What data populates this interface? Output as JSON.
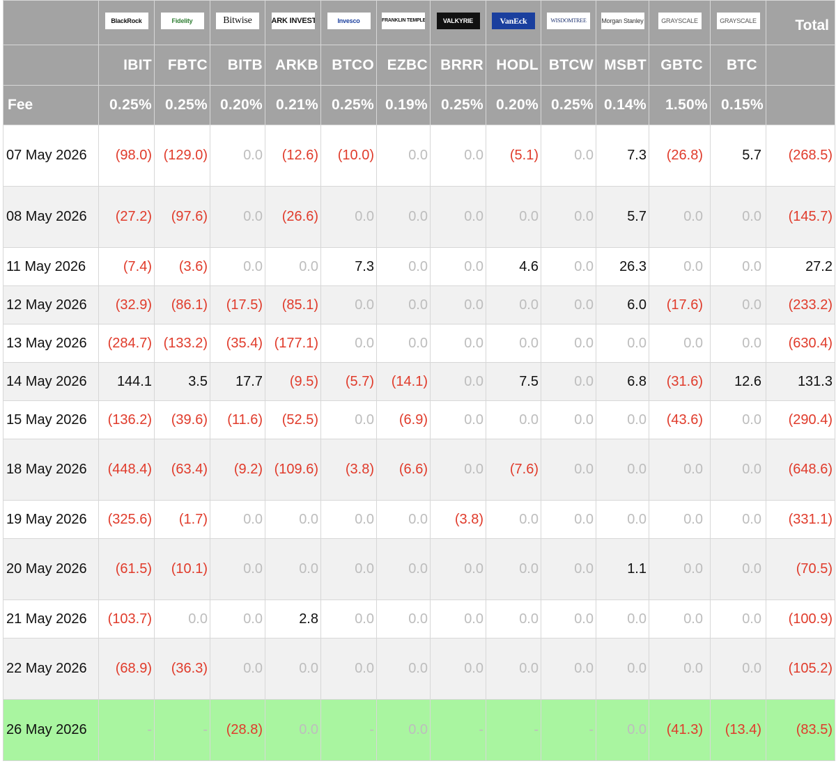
{
  "header": {
    "total_label": "Total",
    "fee_label": "Fee"
  },
  "funds": [
    {
      "logo": "BlackRock",
      "ticker": "IBIT",
      "fee": "0.25%"
    },
    {
      "logo": "Fidelity",
      "ticker": "FBTC",
      "fee": "0.25%"
    },
    {
      "logo": "Bitwise",
      "ticker": "BITB",
      "fee": "0.20%"
    },
    {
      "logo": "ARK INVEST",
      "ticker": "ARKB",
      "fee": "0.21%"
    },
    {
      "logo": "Invesco",
      "ticker": "BTCO",
      "fee": "0.25%"
    },
    {
      "logo": "FRANKLIN TEMPLETON",
      "ticker": "EZBC",
      "fee": "0.19%"
    },
    {
      "logo": "VALKYRIE",
      "ticker": "BRRR",
      "fee": "0.25%"
    },
    {
      "logo": "VanEck",
      "ticker": "HODL",
      "fee": "0.20%"
    },
    {
      "logo": "WISDOMTREE",
      "ticker": "BTCW",
      "fee": "0.25%"
    },
    {
      "logo": "Morgan Stanley",
      "ticker": "MSBT",
      "fee": "0.14%"
    },
    {
      "logo": "GRAYSCALE",
      "ticker": "GBTC",
      "fee": "1.50%"
    },
    {
      "logo": "GRAYSCALE",
      "ticker": "BTC",
      "fee": "0.15%"
    }
  ],
  "rows": [
    {
      "date": "07 May 2026",
      "values": [
        "(98.0)",
        "(129.0)",
        "0.0",
        "(12.6)",
        "(10.0)",
        "0.0",
        "0.0",
        "(5.1)",
        "0.0",
        "7.3",
        "(26.8)",
        "5.7"
      ],
      "total": "(268.5)",
      "height": 89
    },
    {
      "date": "08 May 2026",
      "values": [
        "(27.2)",
        "(97.6)",
        "0.0",
        "(26.6)",
        "0.0",
        "0.0",
        "0.0",
        "0.0",
        "0.0",
        "5.7",
        "0.0",
        "0.0"
      ],
      "total": "(145.7)",
      "height": 89
    },
    {
      "date": "11 May 2026",
      "values": [
        "(7.4)",
        "(3.6)",
        "0.0",
        "0.0",
        "7.3",
        "0.0",
        "0.0",
        "4.6",
        "0.0",
        "26.3",
        "0.0",
        "0.0"
      ],
      "total": "27.2",
      "height": 56
    },
    {
      "date": "12 May 2026",
      "values": [
        "(32.9)",
        "(86.1)",
        "(17.5)",
        "(85.1)",
        "0.0",
        "0.0",
        "0.0",
        "0.0",
        "0.0",
        "6.0",
        "(17.6)",
        "0.0"
      ],
      "total": "(233.2)",
      "height": 56
    },
    {
      "date": "13 May 2026",
      "values": [
        "(284.7)",
        "(133.2)",
        "(35.4)",
        "(177.1)",
        "0.0",
        "0.0",
        "0.0",
        "0.0",
        "0.0",
        "0.0",
        "0.0",
        "0.0"
      ],
      "total": "(630.4)",
      "height": 56
    },
    {
      "date": "14 May 2026",
      "values": [
        "144.1",
        "3.5",
        "17.7",
        "(9.5)",
        "(5.7)",
        "(14.1)",
        "0.0",
        "7.5",
        "0.0",
        "6.8",
        "(31.6)",
        "12.6"
      ],
      "total": "131.3",
      "height": 56
    },
    {
      "date": "15 May 2026",
      "values": [
        "(136.2)",
        "(39.6)",
        "(11.6)",
        "(52.5)",
        "0.0",
        "(6.9)",
        "0.0",
        "0.0",
        "0.0",
        "0.0",
        "(43.6)",
        "0.0"
      ],
      "total": "(290.4)",
      "height": 56
    },
    {
      "date": "18 May 2026",
      "values": [
        "(448.4)",
        "(63.4)",
        "(9.2)",
        "(109.6)",
        "(3.8)",
        "(6.6)",
        "0.0",
        "(7.6)",
        "0.0",
        "0.0",
        "0.0",
        "0.0"
      ],
      "total": "(648.6)",
      "height": 89
    },
    {
      "date": "19 May 2026",
      "values": [
        "(325.6)",
        "(1.7)",
        "0.0",
        "0.0",
        "0.0",
        "0.0",
        "(3.8)",
        "0.0",
        "0.0",
        "0.0",
        "0.0",
        "0.0"
      ],
      "total": "(331.1)",
      "height": 56
    },
    {
      "date": "20 May 2026",
      "values": [
        "(61.5)",
        "(10.1)",
        "0.0",
        "0.0",
        "0.0",
        "0.0",
        "0.0",
        "0.0",
        "0.0",
        "1.1",
        "0.0",
        "0.0"
      ],
      "total": "(70.5)",
      "height": 89
    },
    {
      "date": "21 May 2026",
      "values": [
        "(103.7)",
        "0.0",
        "0.0",
        "2.8",
        "0.0",
        "0.0",
        "0.0",
        "0.0",
        "0.0",
        "0.0",
        "0.0",
        "0.0"
      ],
      "total": "(100.9)",
      "height": 56
    },
    {
      "date": "22 May 2026",
      "values": [
        "(68.9)",
        "(36.3)",
        "0.0",
        "0.0",
        "0.0",
        "0.0",
        "0.0",
        "0.0",
        "0.0",
        "0.0",
        "0.0",
        "0.0"
      ],
      "total": "(105.2)",
      "height": 89
    },
    {
      "date": "26 May 2026",
      "values": [
        "-",
        "-",
        "(28.8)",
        "0.0",
        "-",
        "0.0",
        "-",
        "-",
        "-",
        "0.0",
        "(41.3)",
        "(13.4)"
      ],
      "total": "(83.5)",
      "height": 89,
      "highlight": true
    }
  ],
  "colors": {
    "header_bg": "#a3a3a3",
    "negative": "#e03b2b",
    "zero": "#bdbdbd",
    "highlight_row": "#a9f5a0",
    "stripe": "#f1f1f1"
  }
}
